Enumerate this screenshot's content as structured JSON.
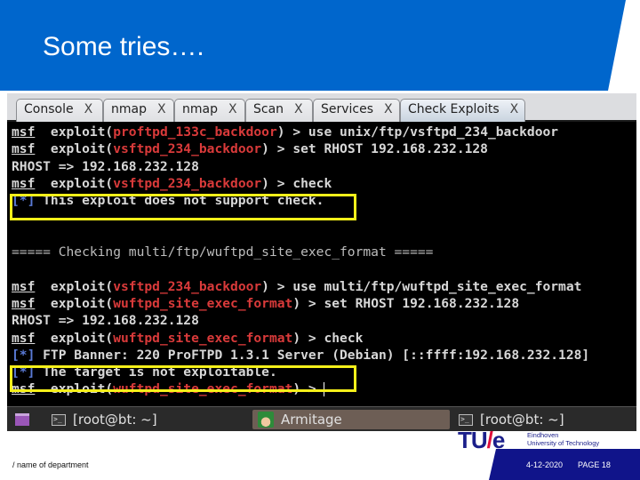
{
  "slide": {
    "title": "Some tries….",
    "footer_department": "/ name of department",
    "footer_date": "4-12-2020",
    "footer_page": "PAGE 18",
    "logo_mark_left": "TU",
    "logo_mark_slash": "/",
    "logo_mark_right": "e",
    "logo_line1": "Eindhoven",
    "logo_line2": "University of Technology",
    "colors": {
      "header_blue": "#0066cc",
      "footer_navy": "#10148a",
      "highlight_yellow": "#f5f01a",
      "module_red": "#d93a3a",
      "info_blue": "#5a7ad6"
    }
  },
  "app": {
    "tabs": [
      {
        "label": "Console",
        "close": "X",
        "active": false
      },
      {
        "label": "nmap",
        "close": "X",
        "active": false
      },
      {
        "label": "nmap",
        "close": "X",
        "active": false
      },
      {
        "label": "Scan",
        "close": "X",
        "active": false
      },
      {
        "label": "Services",
        "close": "X",
        "active": false
      },
      {
        "label": "Check Exploits",
        "close": "X",
        "active": true
      }
    ],
    "terminal": {
      "lines": [
        {
          "prompt": "msf",
          "pre": "  exploit(",
          "module": "proftpd_133c_backdoor",
          "post": ") > use unix/ftp/vsftpd_234_backdoor"
        },
        {
          "prompt": "msf",
          "pre": "  exploit(",
          "module": "vsftpd_234_backdoor",
          "post": ") > set RHOST 192.168.232.128"
        },
        {
          "text": "RHOST => 192.168.232.128"
        },
        {
          "prompt": "msf",
          "pre": "  exploit(",
          "module": "vsftpd_234_backdoor",
          "post": ") > check"
        },
        {
          "marker": "[*]",
          "text": " This exploit does not support check."
        },
        {
          "text": ""
        },
        {
          "text": ""
        },
        {
          "separator": "===== Checking multi/ftp/wuftpd_site_exec_format ====="
        },
        {
          "text": ""
        },
        {
          "prompt": "msf",
          "pre": "  exploit(",
          "module": "vsftpd_234_backdoor",
          "post": ") > use multi/ftp/wuftpd_site_exec_format"
        },
        {
          "prompt": "msf",
          "pre": "  exploit(",
          "module": "wuftpd_site_exec_format",
          "post": ") > set RHOST 192.168.232.128"
        },
        {
          "text": "RHOST => 192.168.232.128"
        },
        {
          "prompt": "msf",
          "pre": "  exploit(",
          "module": "wuftpd_site_exec_format",
          "post": ") > check"
        },
        {
          "marker": "[*]",
          "text": " FTP Banner: 220 ProFTPD 1.3.1 Server (Debian) [::ffff:192.168.232.128]"
        },
        {
          "marker": "[*]",
          "text": " The target is not exploitable."
        },
        {
          "prompt": "msf",
          "pre": "  exploit(",
          "module": "wuftpd_site_exec_format",
          "post": ") > "
        }
      ]
    },
    "taskbar": {
      "items": [
        {
          "label": "[root@bt: ~]",
          "icon": "terminal-icon",
          "active": false
        },
        {
          "label": "Armitage",
          "icon": "armitage-icon",
          "active": true
        },
        {
          "label": "[root@bt: ~]",
          "icon": "terminal-icon",
          "active": false
        }
      ],
      "term_icon_glyph": ">_"
    }
  }
}
